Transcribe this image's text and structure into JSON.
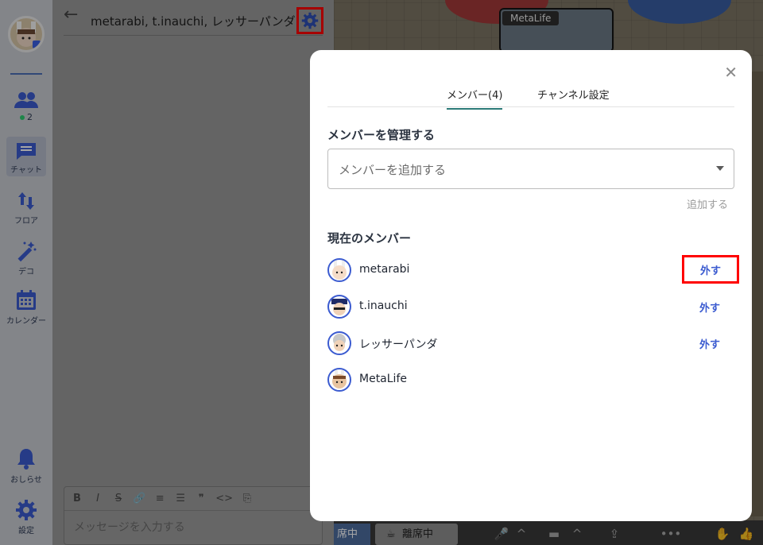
{
  "sidebar": {
    "online_count": "2",
    "items": [
      {
        "label": "チャット",
        "icon": "chat-icon"
      },
      {
        "label": "フロア",
        "icon": "floor-icon"
      },
      {
        "label": "デコ",
        "icon": "magic-wand-icon"
      },
      {
        "label": "カレンダー",
        "icon": "calendar-icon"
      },
      {
        "label": "おしらせ",
        "icon": "bell-icon"
      },
      {
        "label": "設定",
        "icon": "gear-icon"
      }
    ]
  },
  "chat": {
    "title": "metarabi, t.inauchi, レッサーパンダ",
    "composer_placeholder": "メッセージを入力する",
    "toolbar": [
      "B",
      "I",
      "S",
      "🔗",
      "≡",
      "☰",
      "❞",
      "<>",
      "⎘"
    ]
  },
  "map": {
    "label": "MetaLife",
    "away_status": "席中",
    "away_button": "離席中"
  },
  "modal": {
    "tabs": [
      "メンバー(4)",
      "チャンネル設定"
    ],
    "manage_title": "メンバーを管理する",
    "add_placeholder": "メンバーを追加する",
    "add_button": "追加する",
    "current_title": "現在のメンバー",
    "members": [
      {
        "name": "metarabi",
        "action": "外す"
      },
      {
        "name": "t.inauchi",
        "action": "外す"
      },
      {
        "name": "レッサーパンダ",
        "action": "外す"
      },
      {
        "name": "MetaLife",
        "action": ""
      }
    ]
  },
  "colors": {
    "accent": "#3b5bd0",
    "tab_underline": "#2c7a78",
    "highlight": "#ff0000"
  }
}
